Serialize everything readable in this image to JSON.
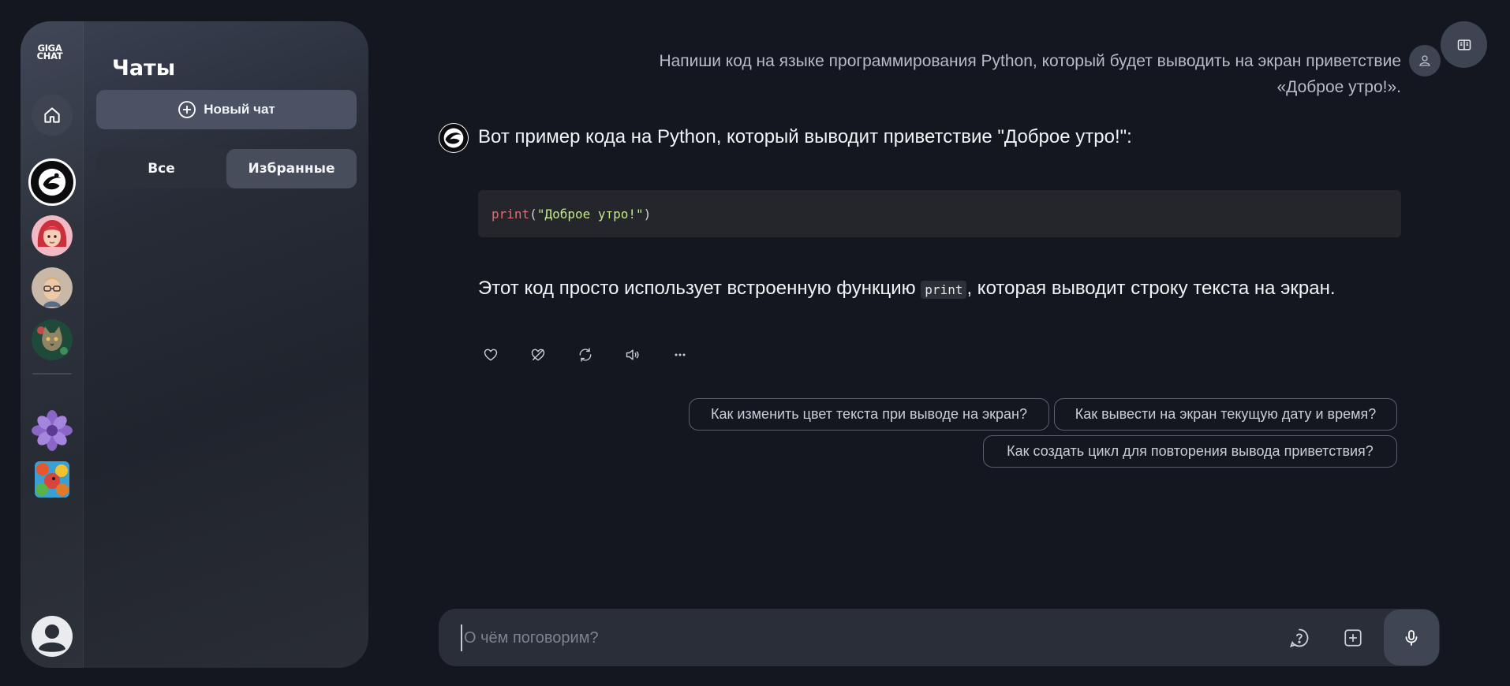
{
  "sidebar": {
    "logo_line1": "GIGA",
    "logo_line2": "CHAT",
    "title": "Чаты",
    "new_chat_label": "Новый чат",
    "filters": [
      {
        "label": "Все",
        "active": false
      },
      {
        "label": "Избранные",
        "active": true
      }
    ],
    "assistants": [
      "gigachat-logo",
      "avatar-red-hair-girl",
      "avatar-glasses-man",
      "avatar-cat",
      "avatar-purple-flower",
      "avatar-colorful-bird"
    ]
  },
  "conversation": {
    "user_message_line1": "Напиши код на языке программирования Python, который будет выводить на экран приветствие",
    "user_message_line2": "«Доброе утро!».",
    "bot_intro": "Вот пример кода на Python, который выводит приветствие \"Доброе утро!\":",
    "code": {
      "fn": "print",
      "open": "(",
      "str": "\"Доброе утро!\"",
      "close": ")"
    },
    "explain_before": "Этот код просто использует встроенную функцию ",
    "explain_code": "print",
    "explain_after": ", которая выводит строку текста на экран.",
    "actions": [
      "like-icon",
      "dislike-icon",
      "regenerate-icon",
      "speaker-icon",
      "more-icon"
    ]
  },
  "suggestions": [
    "Как изменить цвет текста при выводе на экран?",
    "Как вывести на экран текущую дату и время?",
    "Как создать цикл для повторения вывода приветствия?"
  ],
  "input": {
    "placeholder": "О чём поговорим?"
  },
  "colors": {
    "background": "#14171f",
    "panel": "#272c37",
    "accent_button": "#4a5264"
  }
}
